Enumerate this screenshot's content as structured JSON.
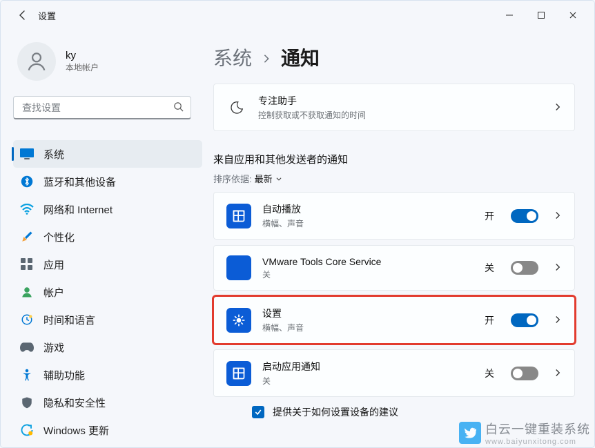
{
  "titlebar": {
    "title": "设置"
  },
  "user": {
    "name": "ky",
    "subtitle": "本地帐户"
  },
  "search": {
    "placeholder": "查找设置"
  },
  "nav": {
    "system": "系统",
    "bluetooth": "蓝牙和其他设备",
    "network": "网络和 Internet",
    "personalize": "个性化",
    "apps": "应用",
    "accounts": "帐户",
    "time": "时间和语言",
    "games": "游戏",
    "accessibility": "辅助功能",
    "privacy": "隐私和安全性",
    "winupdate": "Windows 更新"
  },
  "breadcrumb": {
    "root": "系统",
    "current": "通知"
  },
  "focus": {
    "title": "专注助手",
    "sub": "控制获取或不获取通知的时间"
  },
  "section": {
    "senders_title": "来自应用和其他发送者的通知",
    "sort_label": "排序依据:",
    "sort_value": "最新"
  },
  "states": {
    "on": "开",
    "off": "关"
  },
  "senders": [
    {
      "title": "自动播放",
      "sub": "横幅、声音",
      "state": "on",
      "icon": "autoplay"
    },
    {
      "title": "VMware Tools Core Service",
      "sub": "关",
      "state": "off",
      "icon": "blank"
    },
    {
      "title": "设置",
      "sub": "横幅、声音",
      "state": "on",
      "icon": "settings",
      "highlight": true
    },
    {
      "title": "启动应用通知",
      "sub": "关",
      "state": "off",
      "icon": "autoplay"
    }
  ],
  "tips": {
    "label": "提供关于如何设置设备的建议"
  },
  "watermark": {
    "line1": "白云一键重装系统",
    "line2": "www.baiyunxitong.com"
  }
}
